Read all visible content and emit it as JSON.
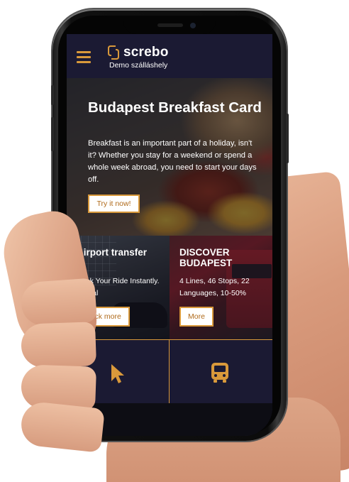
{
  "header": {
    "brand": "screbo",
    "subtitle": "Demo szálláshely"
  },
  "hero": {
    "title": "Budapest Breakfast Card",
    "text": "Breakfast is an important part of a holiday, isn't it? Whether you stay for a weekend or spend a whole week abroad, you need to start your days off.",
    "button": "Try it now!"
  },
  "cards": [
    {
      "title": "Airport transfer",
      "text": "Book Your Ride Instantly. Global",
      "button": "Click more"
    },
    {
      "title": "DISCOVER BUDAPEST",
      "text": "4 Lines, 46 Stops, 22 Languages, 10-50%",
      "button": "More"
    }
  ],
  "bottom_nav": {
    "items": [
      {
        "icon": "cursor-icon"
      },
      {
        "icon": "bus-icon"
      }
    ]
  },
  "colors": {
    "accent": "#d9993b",
    "background": "#1b1a33",
    "button_text": "#b06a1a"
  }
}
